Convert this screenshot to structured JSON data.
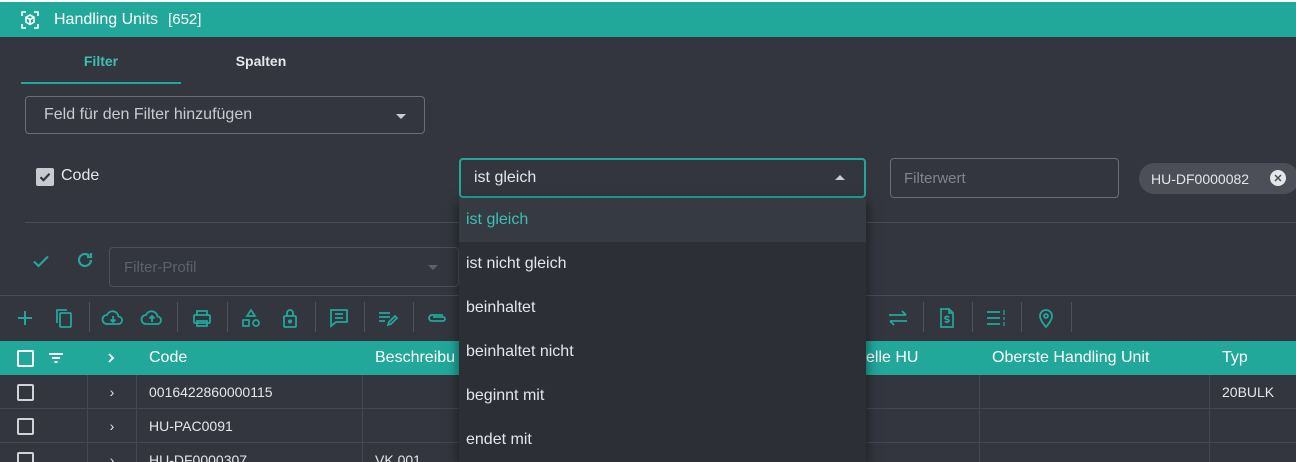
{
  "window": {
    "title": "Handling Units",
    "count": "[652]"
  },
  "tabs": [
    {
      "label": "Filter"
    },
    {
      "label": "Spalten"
    }
  ],
  "add_filter": {
    "placeholder": "Feld für den Filter hinzufügen"
  },
  "filter_row": {
    "field_label": "Code",
    "operator_value": "ist gleich",
    "value_placeholder": "Filterwert",
    "chip_value": "HU-DF0000082"
  },
  "profile": {
    "placeholder": "Filter-Profil"
  },
  "operator_options": [
    {
      "label": "ist gleich"
    },
    {
      "label": "ist nicht gleich"
    },
    {
      "label": "beinhaltet"
    },
    {
      "label": "beinhaltet nicht"
    },
    {
      "label": "beginnt mit"
    },
    {
      "label": "endet mit"
    }
  ],
  "table": {
    "columns": {
      "code": "Code",
      "beschreibung": "Beschreibu",
      "aktuelle_hu": "elle HU",
      "oberste_hu": "Oberste Handling Unit",
      "typ": "Typ"
    },
    "rows": [
      {
        "code": "0016422860000115",
        "beschreibung": "",
        "typ": "20BULK"
      },
      {
        "code": "HU-PAC0091",
        "beschreibung": "",
        "typ": ""
      },
      {
        "code": "HU-DF0000307",
        "beschreibung": "VK 001",
        "typ": ""
      }
    ]
  },
  "colors": {
    "accent": "#21a89b",
    "accent_text": "#3bc0b3",
    "background": "#33363f",
    "dropdown": "#2c2f36"
  },
  "toolbar_icons": [
    "add-icon",
    "copy-icon",
    "cloud-download-icon",
    "cloud-upload-icon",
    "print-icon",
    "shapes-icon",
    "lock-icon",
    "comment-icon",
    "edit-list-icon",
    "attachment-icon",
    "sort-icon",
    "swap-icon",
    "invoice-icon",
    "list-numbered-icon",
    "location-pin-icon"
  ]
}
